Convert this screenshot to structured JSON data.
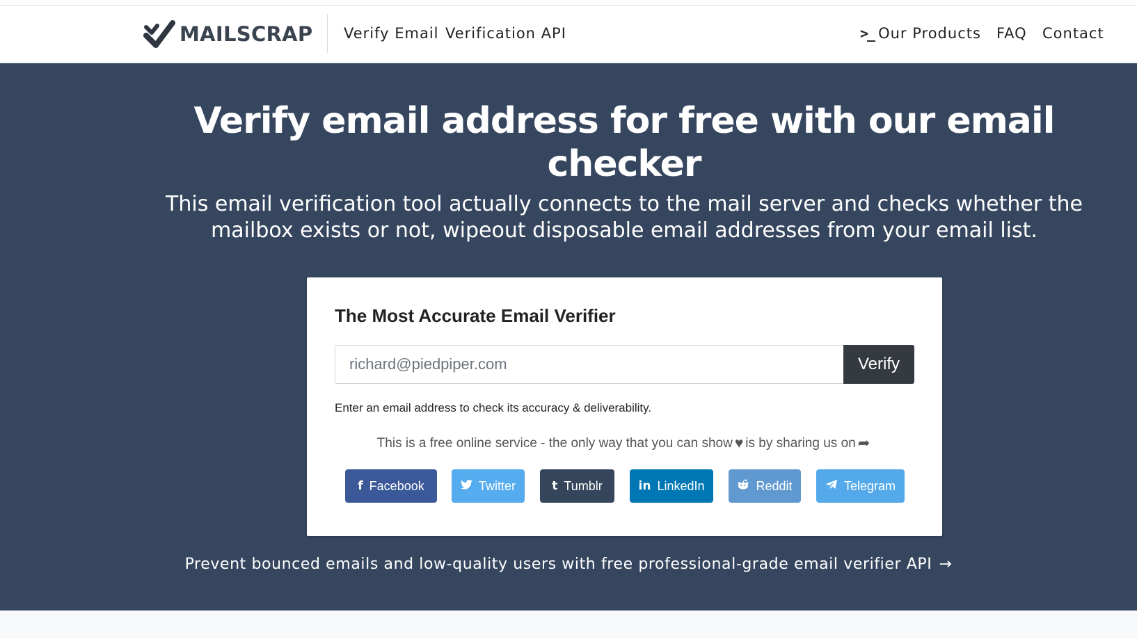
{
  "nav": {
    "brand": "MAILSCRAP",
    "logo_icon": "checkmark-logo-icon",
    "links": {
      "verify_email": "Verify Email",
      "verification_api": "Verification API",
      "products_icon": "terminal-prompt-icon",
      "our_products": "Our Products",
      "faq": "FAQ",
      "contact": "Contact"
    }
  },
  "hero": {
    "title": "Verify email address for free with our email checker",
    "subtitle": "This email verification tool actually connects to the mail server and checks whether the mailbox exists or not, wipeout disposable email addresses from your email list.",
    "background": "#36465f"
  },
  "card": {
    "title": "The Most Accurate Email Verifier",
    "input": {
      "value": "",
      "placeholder": "richard@piedpiper.com"
    },
    "verify_label": "Verify",
    "help": "Enter an email address to check its accuracy & deliverability.",
    "share_line": {
      "before": "This is a free online service - the only way that you can show",
      "heart_icon": "heart-icon",
      "after": "is by sharing us on",
      "share_icon": "share-arrow-icon"
    },
    "share_buttons": {
      "facebook": "Facebook",
      "twitter": "Twitter",
      "tumblr": "Tumblr",
      "linkedin": "LinkedIn",
      "reddit": "Reddit",
      "telegram": "Telegram"
    }
  },
  "api_promo": {
    "text": "Prevent bounced emails and low-quality users with free professional-grade email verifier API",
    "arrow": "→"
  }
}
